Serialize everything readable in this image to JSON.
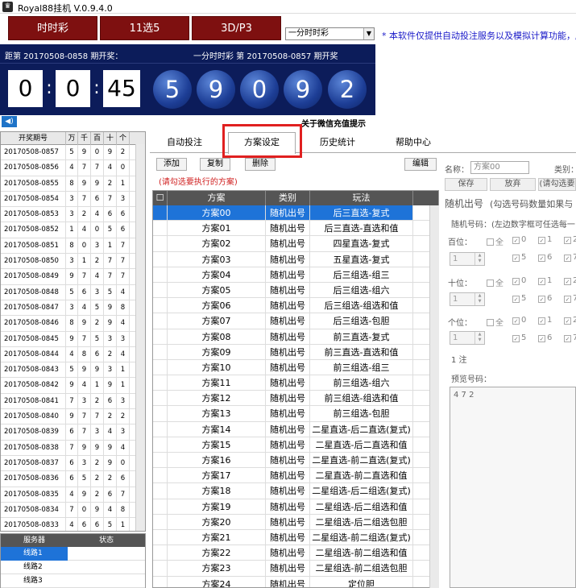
{
  "window": {
    "title": "Royal88挂机 V.0.9.4.0"
  },
  "lottery_buttons": [
    "时时彩",
    "11选5",
    "3D/P3"
  ],
  "lottery_select": "一分时时彩",
  "notice": "* 本软件仅提供自动投注服务以及模拟计算功能，所",
  "panel": {
    "left_caption": "距第 20170508-0858 期开奖：",
    "right_caption": "一分时时彩 第 20170508-0857 期开奖",
    "countdown": [
      "0",
      "0",
      "45"
    ],
    "balls": [
      "5",
      "9",
      "0",
      "9",
      "2"
    ]
  },
  "wechat_tip": "关于微信充值提示",
  "history": {
    "headers": [
      "开奖期号",
      "万",
      "千",
      "百",
      "十",
      "个"
    ],
    "rows": [
      [
        "20170508-0857",
        "5",
        "9",
        "0",
        "9",
        "2"
      ],
      [
        "20170508-0856",
        "4",
        "7",
        "7",
        "4",
        "0"
      ],
      [
        "20170508-0855",
        "8",
        "9",
        "9",
        "2",
        "1"
      ],
      [
        "20170508-0854",
        "3",
        "7",
        "6",
        "7",
        "3"
      ],
      [
        "20170508-0853",
        "3",
        "2",
        "4",
        "6",
        "6"
      ],
      [
        "20170508-0852",
        "1",
        "4",
        "0",
        "5",
        "6"
      ],
      [
        "20170508-0851",
        "8",
        "0",
        "3",
        "1",
        "7"
      ],
      [
        "20170508-0850",
        "3",
        "1",
        "2",
        "7",
        "7"
      ],
      [
        "20170508-0849",
        "9",
        "7",
        "4",
        "7",
        "7"
      ],
      [
        "20170508-0848",
        "5",
        "6",
        "3",
        "5",
        "4"
      ],
      [
        "20170508-0847",
        "3",
        "4",
        "5",
        "9",
        "8"
      ],
      [
        "20170508-0846",
        "8",
        "9",
        "2",
        "9",
        "4"
      ],
      [
        "20170508-0845",
        "9",
        "7",
        "5",
        "3",
        "3"
      ],
      [
        "20170508-0844",
        "4",
        "8",
        "6",
        "2",
        "4"
      ],
      [
        "20170508-0843",
        "5",
        "9",
        "9",
        "3",
        "1"
      ],
      [
        "20170508-0842",
        "9",
        "4",
        "1",
        "9",
        "1"
      ],
      [
        "20170508-0841",
        "7",
        "3",
        "2",
        "6",
        "3"
      ],
      [
        "20170508-0840",
        "9",
        "7",
        "7",
        "2",
        "2"
      ],
      [
        "20170508-0839",
        "6",
        "7",
        "3",
        "4",
        "3"
      ],
      [
        "20170508-0838",
        "7",
        "9",
        "9",
        "9",
        "4"
      ],
      [
        "20170508-0837",
        "6",
        "3",
        "2",
        "9",
        "0"
      ],
      [
        "20170508-0836",
        "6",
        "5",
        "2",
        "2",
        "6"
      ],
      [
        "20170508-0835",
        "4",
        "9",
        "2",
        "6",
        "7"
      ],
      [
        "20170508-0834",
        "7",
        "0",
        "9",
        "4",
        "8"
      ],
      [
        "20170508-0833",
        "4",
        "6",
        "6",
        "5",
        "1"
      ]
    ]
  },
  "servers": {
    "headers": [
      "服务器",
      "状态"
    ],
    "rows": [
      [
        "线路1",
        ""
      ],
      [
        "线路2",
        ""
      ],
      [
        "线路3",
        ""
      ]
    ]
  },
  "tabs": [
    "自动投注",
    "方案设定",
    "历史统计",
    "帮助中心"
  ],
  "plan_buttons": {
    "add": "添加",
    "copy": "复制",
    "delete": "删除",
    "edit": "编辑"
  },
  "plan_hint": "(请勾选要执行的方案)",
  "plans": {
    "headers": [
      "方案",
      "类别",
      "玩法"
    ],
    "rows": [
      [
        "方案00",
        "随机出号",
        "后三直选-复式"
      ],
      [
        "方案01",
        "随机出号",
        "后三直选-直选和值"
      ],
      [
        "方案02",
        "随机出号",
        "四星直选-复式"
      ],
      [
        "方案03",
        "随机出号",
        "五星直选-复式"
      ],
      [
        "方案04",
        "随机出号",
        "后三组选-组三"
      ],
      [
        "方案05",
        "随机出号",
        "后三组选-组六"
      ],
      [
        "方案06",
        "随机出号",
        "后三组选-组选和值"
      ],
      [
        "方案07",
        "随机出号",
        "后三组选-包胆"
      ],
      [
        "方案08",
        "随机出号",
        "前三直选-复式"
      ],
      [
        "方案09",
        "随机出号",
        "前三直选-直选和值"
      ],
      [
        "方案10",
        "随机出号",
        "前三组选-组三"
      ],
      [
        "方案11",
        "随机出号",
        "前三组选-组六"
      ],
      [
        "方案12",
        "随机出号",
        "前三组选-组选和值"
      ],
      [
        "方案13",
        "随机出号",
        "前三组选-包胆"
      ],
      [
        "方案14",
        "随机出号",
        "二星直选-后二直选(复式)"
      ],
      [
        "方案15",
        "随机出号",
        "二星直选-后二直选和值"
      ],
      [
        "方案16",
        "随机出号",
        "二星直选-前二直选(复式)"
      ],
      [
        "方案17",
        "随机出号",
        "二星直选-前二直选和值"
      ],
      [
        "方案18",
        "随机出号",
        "二星组选-后二组选(复式)"
      ],
      [
        "方案19",
        "随机出号",
        "二星组选-后二组选和值"
      ],
      [
        "方案20",
        "随机出号",
        "二星组选-后二组选包胆"
      ],
      [
        "方案21",
        "随机出号",
        "二星组选-前二组选(复式)"
      ],
      [
        "方案22",
        "随机出号",
        "二星组选-前二组选和值"
      ],
      [
        "方案23",
        "随机出号",
        "二星组选-前二组选包胆"
      ],
      [
        "方案24",
        "随机出号",
        "定位胆"
      ]
    ]
  },
  "detail": {
    "name_label": "名称：",
    "name_value": "方案00",
    "type_label": "类别：",
    "save": "保存",
    "discard": "放弃",
    "hint_btn": "(请勾选要",
    "random_title": "随机出号",
    "random_note": "(勾选号码数量如果与",
    "random_code_label": "随机号码：(左边数字框可任选每一",
    "positions": [
      "百位：",
      "十位：",
      "个位："
    ],
    "all_label": "全",
    "spin_value": "1",
    "digits_row1": [
      "0",
      "1",
      "2"
    ],
    "digits_row2": [
      "5",
      "6",
      "7"
    ],
    "count": "1 注",
    "preview_label": "预览号码：",
    "preview_value": "4 7 2"
  }
}
